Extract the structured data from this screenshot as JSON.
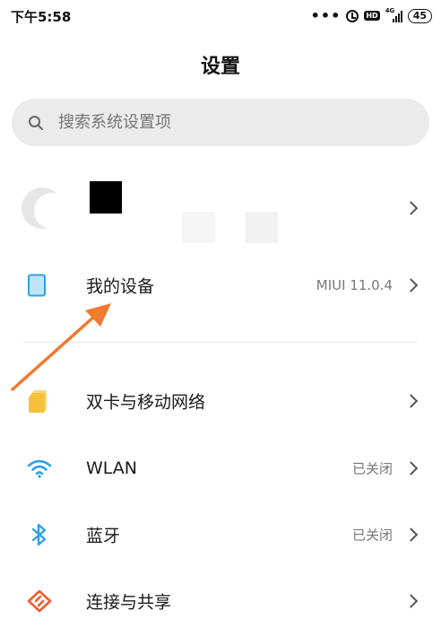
{
  "status_bar": {
    "time": "下午5:58",
    "notification_dots": "•••",
    "hd_label": "HD",
    "network_type": "4G",
    "battery_level": "45"
  },
  "header": {
    "title": "设置"
  },
  "search": {
    "placeholder": "搜索系统设置项"
  },
  "list": {
    "my_device": {
      "label": "我的设备",
      "value": "MIUI 11.0.4"
    },
    "sim_network": {
      "label": "双卡与移动网络"
    },
    "wlan": {
      "label": "WLAN",
      "value": "已关闭"
    },
    "bluetooth": {
      "label": "蓝牙",
      "value": "已关闭"
    },
    "connection_sharing": {
      "label": "连接与共享"
    }
  },
  "icons": {
    "my_device": "phone-device-icon",
    "sim_network": "sim-card-icon",
    "wlan": "wifi-icon",
    "bluetooth": "bluetooth-icon",
    "connection_sharing": "connection-share-icon"
  },
  "colors": {
    "accent_blue": "#2ea0e6",
    "sim_yellow": "#f5c13a",
    "share_orange": "#ef5b2f",
    "annotation_arrow": "#f07a2e"
  }
}
